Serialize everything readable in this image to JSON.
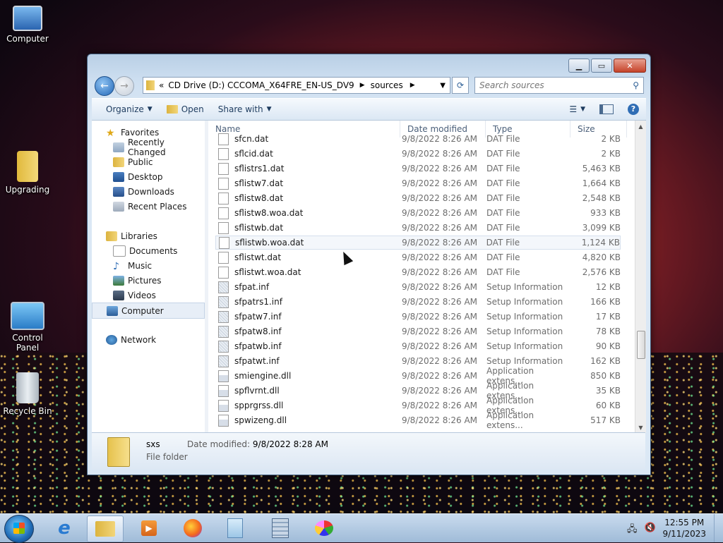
{
  "desktop": {
    "icons": [
      {
        "label": "Computer"
      },
      {
        "label": "Upgrading"
      },
      {
        "label": "Control Panel"
      },
      {
        "label": "Recycle Bin"
      }
    ]
  },
  "window": {
    "address": {
      "overflow": "«",
      "segments": [
        "CD Drive (D:) CCCOMA_X64FRE_EN-US_DV9",
        "sources"
      ]
    },
    "search_placeholder": "Search sources",
    "toolbar": {
      "organize": "Organize",
      "open": "Open",
      "share_with": "Share with"
    },
    "nav": {
      "favorites": {
        "label": "Favorites",
        "items": [
          "Recently Changed",
          "Public",
          "Desktop",
          "Downloads",
          "Recent Places"
        ]
      },
      "libraries": {
        "label": "Libraries",
        "items": [
          "Documents",
          "Music",
          "Pictures",
          "Videos"
        ]
      },
      "computer": "Computer",
      "network": "Network"
    },
    "columns": {
      "name": "Name",
      "date": "Date modified",
      "type": "Type",
      "size": "Size"
    },
    "files": [
      {
        "name": "sfcn.dat",
        "date": "9/8/2022 8:26 AM",
        "type": "DAT File",
        "size": "2 KB",
        "kind": "dat"
      },
      {
        "name": "sflcid.dat",
        "date": "9/8/2022 8:26 AM",
        "type": "DAT File",
        "size": "2 KB",
        "kind": "dat"
      },
      {
        "name": "sflistrs1.dat",
        "date": "9/8/2022 8:26 AM",
        "type": "DAT File",
        "size": "5,463 KB",
        "kind": "dat"
      },
      {
        "name": "sflistw7.dat",
        "date": "9/8/2022 8:26 AM",
        "type": "DAT File",
        "size": "1,664 KB",
        "kind": "dat"
      },
      {
        "name": "sflistw8.dat",
        "date": "9/8/2022 8:26 AM",
        "type": "DAT File",
        "size": "2,548 KB",
        "kind": "dat"
      },
      {
        "name": "sflistw8.woa.dat",
        "date": "9/8/2022 8:26 AM",
        "type": "DAT File",
        "size": "933 KB",
        "kind": "dat"
      },
      {
        "name": "sflistwb.dat",
        "date": "9/8/2022 8:26 AM",
        "type": "DAT File",
        "size": "3,099 KB",
        "kind": "dat"
      },
      {
        "name": "sflistwb.woa.dat",
        "date": "9/8/2022 8:26 AM",
        "type": "DAT File",
        "size": "1,124 KB",
        "kind": "dat",
        "hover": true
      },
      {
        "name": "sflistwt.dat",
        "date": "9/8/2022 8:26 AM",
        "type": "DAT File",
        "size": "4,820 KB",
        "kind": "dat"
      },
      {
        "name": "sflistwt.woa.dat",
        "date": "9/8/2022 8:26 AM",
        "type": "DAT File",
        "size": "2,576 KB",
        "kind": "dat"
      },
      {
        "name": "sfpat.inf",
        "date": "9/8/2022 8:26 AM",
        "type": "Setup Information",
        "size": "12 KB",
        "kind": "inf"
      },
      {
        "name": "sfpatrs1.inf",
        "date": "9/8/2022 8:26 AM",
        "type": "Setup Information",
        "size": "166 KB",
        "kind": "inf"
      },
      {
        "name": "sfpatw7.inf",
        "date": "9/8/2022 8:26 AM",
        "type": "Setup Information",
        "size": "17 KB",
        "kind": "inf"
      },
      {
        "name": "sfpatw8.inf",
        "date": "9/8/2022 8:26 AM",
        "type": "Setup Information",
        "size": "78 KB",
        "kind": "inf"
      },
      {
        "name": "sfpatwb.inf",
        "date": "9/8/2022 8:26 AM",
        "type": "Setup Information",
        "size": "90 KB",
        "kind": "inf"
      },
      {
        "name": "sfpatwt.inf",
        "date": "9/8/2022 8:26 AM",
        "type": "Setup Information",
        "size": "162 KB",
        "kind": "inf"
      },
      {
        "name": "smiengine.dll",
        "date": "9/8/2022 8:26 AM",
        "type": "Application extens...",
        "size": "850 KB",
        "kind": "dll"
      },
      {
        "name": "spflvrnt.dll",
        "date": "9/8/2022 8:26 AM",
        "type": "Application extens...",
        "size": "35 KB",
        "kind": "dll"
      },
      {
        "name": "spprgrss.dll",
        "date": "9/8/2022 8:26 AM",
        "type": "Application extens...",
        "size": "60 KB",
        "kind": "dll"
      },
      {
        "name": "spwizeng.dll",
        "date": "9/8/2022 8:26 AM",
        "type": "Application extens...",
        "size": "517 KB",
        "kind": "dll"
      }
    ],
    "details": {
      "name": "sxs",
      "date_label": "Date modified:",
      "date_value": "9/8/2022 8:28 AM",
      "type": "File folder"
    }
  },
  "taskbar": {
    "time": "12:55 PM",
    "date": "9/11/2023",
    "apps": [
      "internet-explorer",
      "file-explorer",
      "media-player",
      "firefox",
      "notepad",
      "calculator",
      "paint"
    ]
  }
}
